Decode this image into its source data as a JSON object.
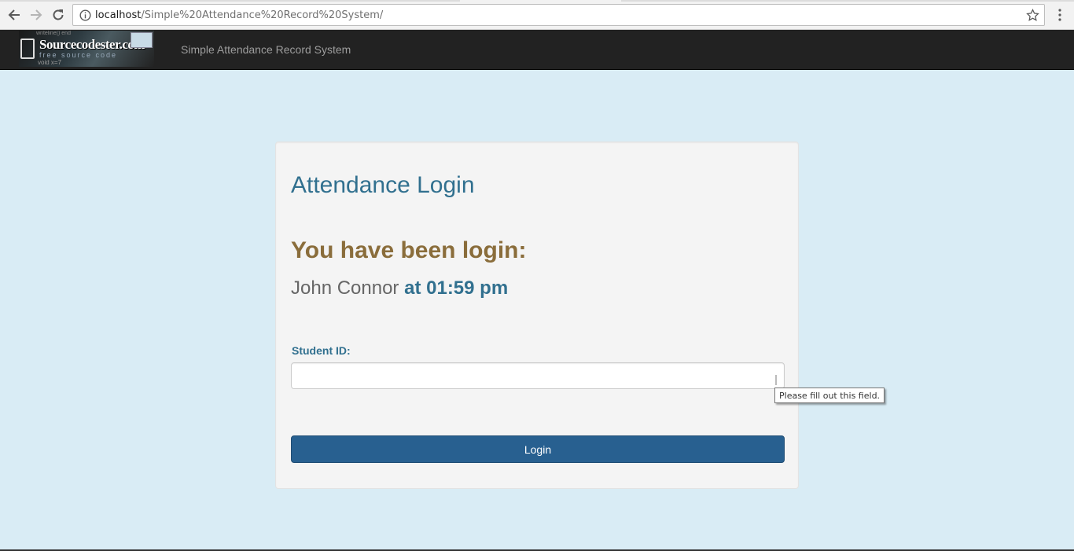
{
  "browser": {
    "url_host": "localhost",
    "url_path": "/Simple%20Attendance%20Record%20System/"
  },
  "navbar": {
    "logo_text": "Sourcecodester.com",
    "logo_tagline": "free source code",
    "logo_deco_top": "writeline()   end",
    "logo_deco_bottom": "void    x=7",
    "title": "Simple Attendance Record System"
  },
  "card": {
    "title": "Attendance Login",
    "status_heading": "You have been login:",
    "user_name": "John Connor",
    "login_time": "at 01:59 pm",
    "student_id_label": "Student ID:",
    "student_id_value": "",
    "login_button": "Login"
  },
  "tooltip": {
    "text": "Please fill out this field."
  },
  "colors": {
    "navbar_bg": "#222222",
    "page_bg": "#d9ecf5",
    "primary": "#286090",
    "info_text": "#31708f",
    "warning_text": "#8a6d3b"
  },
  "icons": [
    "back-arrow-icon",
    "forward-arrow-icon",
    "reload-icon",
    "info-icon",
    "star-icon",
    "menu-dots-icon"
  ]
}
